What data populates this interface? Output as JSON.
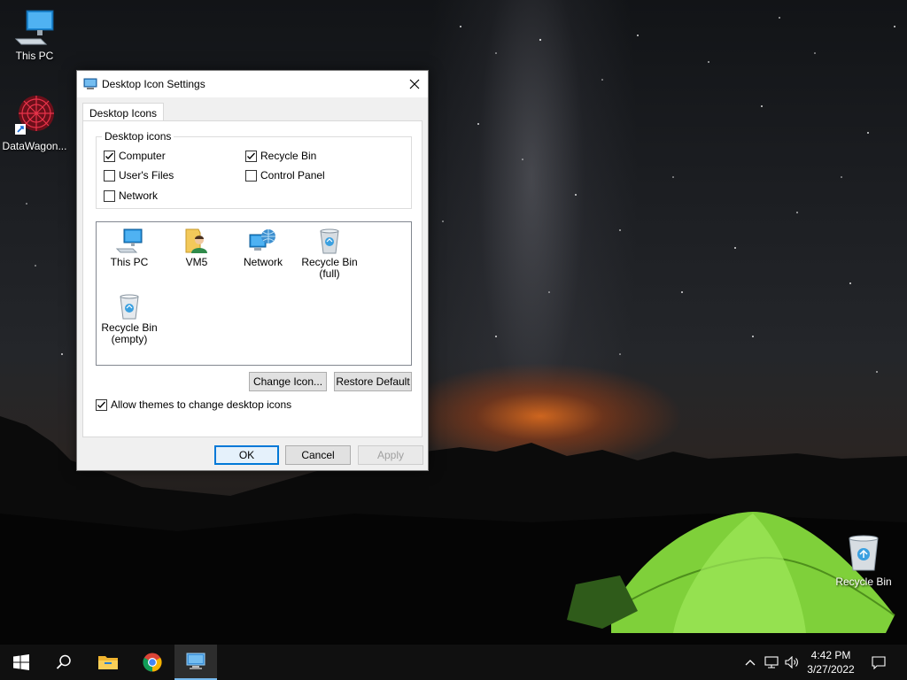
{
  "desktop": {
    "icons": [
      {
        "label": "This PC",
        "icon": "this-pc-icon"
      },
      {
        "label": "DataWagon...",
        "icon": "datawagon-shortcut-icon"
      },
      {
        "label": "Recycle Bin",
        "icon": "recycle-bin-full-icon"
      }
    ]
  },
  "dialog": {
    "title": "Desktop Icon Settings",
    "tab_label": "Desktop Icons",
    "group_label": "Desktop icons",
    "checkboxes": [
      {
        "label": "Computer",
        "checked": true
      },
      {
        "label": "Recycle Bin",
        "checked": true
      },
      {
        "label": "User's Files",
        "checked": false
      },
      {
        "label": "Control Panel",
        "checked": false
      },
      {
        "label": "Network",
        "checked": false
      }
    ],
    "icon_list": [
      {
        "label": "This PC",
        "icon": "this-pc-icon"
      },
      {
        "label": "VM5",
        "icon": "user-folder-icon"
      },
      {
        "label": "Network",
        "icon": "network-icon"
      },
      {
        "label_lines": [
          "Recycle Bin",
          "(full)"
        ],
        "icon": "recycle-bin-full-icon"
      },
      {
        "label_lines": [
          "Recycle Bin",
          "(empty)"
        ],
        "icon": "recycle-bin-empty-icon"
      }
    ],
    "change_icon_label": "Change Icon...",
    "restore_default_label": "Restore Default",
    "allow_themes_label": "Allow themes to change desktop icons",
    "allow_themes_checked": true,
    "ok_label": "OK",
    "cancel_label": "Cancel",
    "apply_label": "Apply"
  },
  "taskbar": {
    "apps": [
      "start-icon",
      "search-icon",
      "file-explorer-icon",
      "chrome-icon",
      "display-settings-icon"
    ],
    "tray": [
      "chevron-up-icon",
      "network-icon",
      "volume-icon"
    ],
    "time": "4:42 PM",
    "date": "3/27/2022",
    "notification_icon": "action-center-icon"
  },
  "colors": {
    "accent": "#0078d7",
    "taskbar": "#101010",
    "dialog_bg": "#f0f0f0"
  }
}
